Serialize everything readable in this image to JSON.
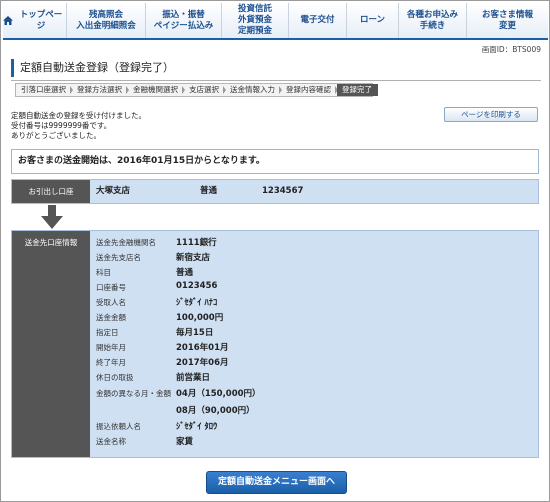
{
  "nav": {
    "items": [
      {
        "label": "トップページ"
      },
      {
        "label1": "残高照会",
        "label2": "入出金明細照会"
      },
      {
        "label1": "振込・振替",
        "label2": "ペイジー払込み"
      },
      {
        "label1": "投資信託",
        "label2": "外貨預金",
        "label3": "定期預金"
      },
      {
        "label1": "電子交付"
      },
      {
        "label1": "ローン"
      },
      {
        "label1": "各種お申込み",
        "label2": "手続き"
      },
      {
        "label1": "お客さま情報",
        "label2": "変更"
      }
    ]
  },
  "screen_id": "画面ID：BTS009",
  "title": "定額自動送金登録（登録完了）",
  "steps": [
    "引落口座選択",
    "登録方法選択",
    "金融機関選択",
    "支店選択",
    "送金情報入力",
    "登録内容確認",
    "登録完了"
  ],
  "message": {
    "line1": "定額自動送金の登録を受け付けました。",
    "line2": "受付番号は9999999番です。",
    "line3": "ありがとうございました。"
  },
  "print_button": "ページを印刷する",
  "notice": "お客さまの送金開始は、2016年01月15日からとなります。",
  "withdrawal": {
    "label": "お引出し口座",
    "branch": "大塚支店",
    "type": "普通",
    "number": "1234567"
  },
  "destination": {
    "label": "送金先口座情報",
    "rows": [
      {
        "label": "送金先金融機関名",
        "value": "1111銀行"
      },
      {
        "label": "送金先支店名",
        "value": "新宿支店"
      },
      {
        "label": "科目",
        "value": "普通"
      },
      {
        "label": "口座番号",
        "value": "0123456"
      },
      {
        "label": "受取人名",
        "value": "ｼﾞｾﾀﾞｲ ﾊﾅｺ"
      },
      {
        "label": "送金金額",
        "value": "100,000円"
      },
      {
        "label": "指定日",
        "value": "毎月15日"
      },
      {
        "label": "開始年月",
        "value": "2016年01月"
      },
      {
        "label": "終了年月",
        "value": "2017年06月"
      },
      {
        "label": "休日の取扱",
        "value": "前営業日"
      },
      {
        "label": "金額の異なる月・金額",
        "value": "04月（150,000円）"
      },
      {
        "label": "",
        "value": "08月（90,000円）"
      },
      {
        "label": "振込依頼人名",
        "value": "ｼﾞｾﾀﾞｲ ﾀﾛｳ"
      },
      {
        "label": "送金名称",
        "value": "家賃"
      }
    ]
  },
  "menu_button": "定額自動送金メニュー画面へ"
}
